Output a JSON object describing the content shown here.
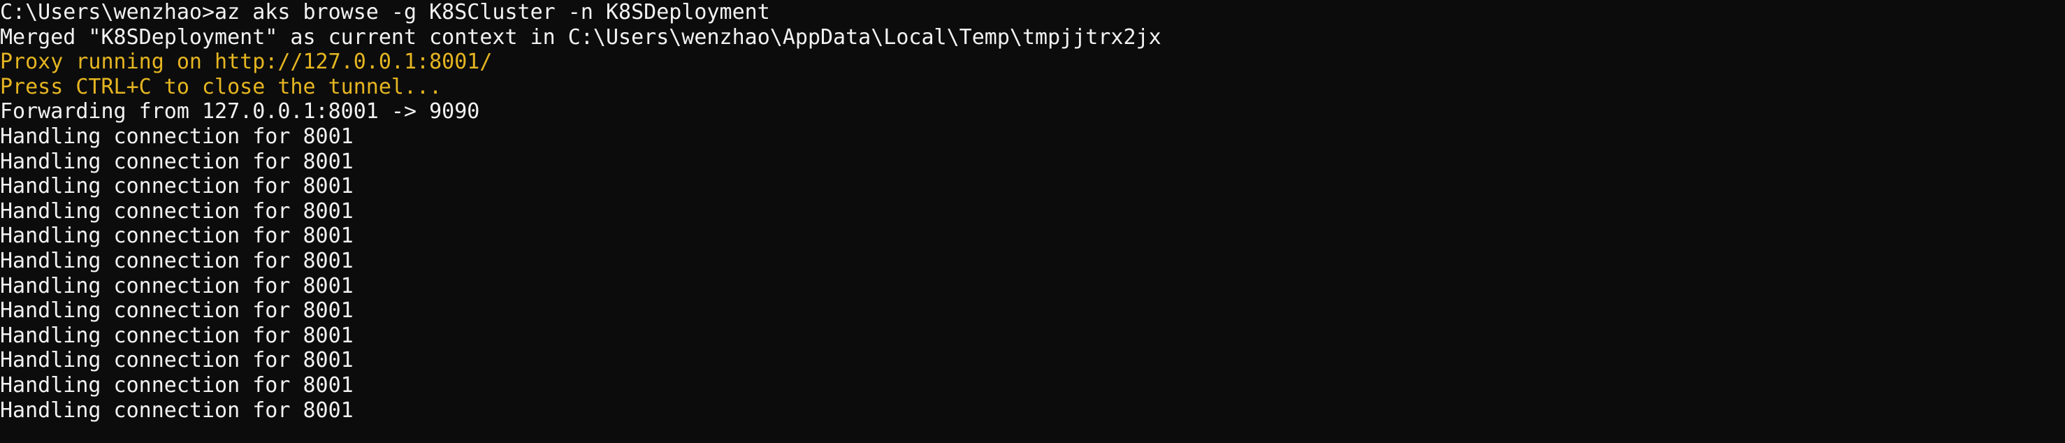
{
  "terminal": {
    "lines": [
      {
        "text": "C:\\Users\\wenzhao>az aks browse -g K8SCluster -n K8SDeployment",
        "style": "normal"
      },
      {
        "text": "Merged \"K8SDeployment\" as current context in C:\\Users\\wenzhao\\AppData\\Local\\Temp\\tmpjjtrx2jx",
        "style": "normal"
      },
      {
        "text": "Proxy running on http://127.0.0.1:8001/",
        "style": "warn"
      },
      {
        "text": "Press CTRL+C to close the tunnel...",
        "style": "warn"
      },
      {
        "text": "Forwarding from 127.0.0.1:8001 -> 9090",
        "style": "normal"
      },
      {
        "text": "Handling connection for 8001",
        "style": "normal"
      },
      {
        "text": "Handling connection for 8001",
        "style": "normal"
      },
      {
        "text": "Handling connection for 8001",
        "style": "normal"
      },
      {
        "text": "Handling connection for 8001",
        "style": "normal"
      },
      {
        "text": "Handling connection for 8001",
        "style": "normal"
      },
      {
        "text": "Handling connection for 8001",
        "style": "normal"
      },
      {
        "text": "Handling connection for 8001",
        "style": "normal"
      },
      {
        "text": "Handling connection for 8001",
        "style": "normal"
      },
      {
        "text": "Handling connection for 8001",
        "style": "normal"
      },
      {
        "text": "Handling connection for 8001",
        "style": "normal"
      },
      {
        "text": "Handling connection for 8001",
        "style": "normal"
      },
      {
        "text": "Handling connection for 8001",
        "style": "normal"
      }
    ]
  },
  "colors": {
    "background": "#0c0c0c",
    "text": "#f2f2f2",
    "warning": "#e5b521"
  }
}
